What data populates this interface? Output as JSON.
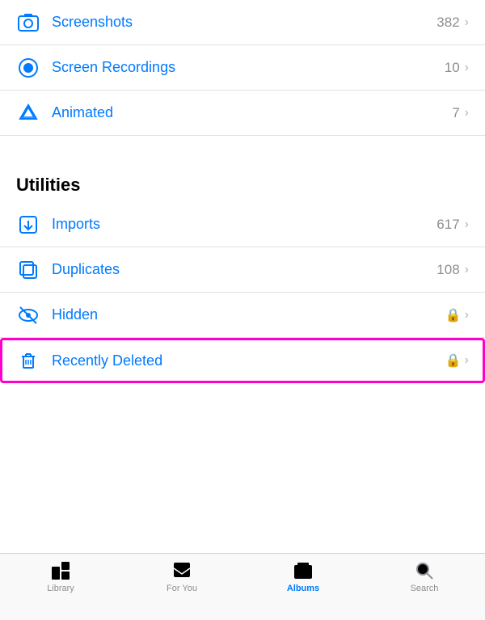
{
  "items": [
    {
      "id": "screenshots",
      "label": "Screenshots",
      "count": "382",
      "hasLock": false,
      "iconType": "camera"
    },
    {
      "id": "screen-recordings",
      "label": "Screen Recordings",
      "count": "10",
      "hasLock": false,
      "iconType": "record"
    },
    {
      "id": "animated",
      "label": "Animated",
      "count": "7",
      "hasLock": false,
      "iconType": "animated"
    }
  ],
  "section_header": "Utilities",
  "utilities": [
    {
      "id": "imports",
      "label": "Imports",
      "count": "617",
      "hasLock": false,
      "iconType": "import"
    },
    {
      "id": "duplicates",
      "label": "Duplicates",
      "count": "108",
      "hasLock": false,
      "iconType": "duplicate"
    },
    {
      "id": "hidden",
      "label": "Hidden",
      "count": "",
      "hasLock": true,
      "iconType": "hidden"
    },
    {
      "id": "recently-deleted",
      "label": "Recently Deleted",
      "count": "",
      "hasLock": true,
      "iconType": "trash",
      "highlighted": true
    }
  ],
  "tabs": [
    {
      "id": "library",
      "label": "Library",
      "active": false
    },
    {
      "id": "for-you",
      "label": "For You",
      "active": false
    },
    {
      "id": "albums",
      "label": "Albums",
      "active": true
    },
    {
      "id": "search",
      "label": "Search",
      "active": false
    }
  ]
}
